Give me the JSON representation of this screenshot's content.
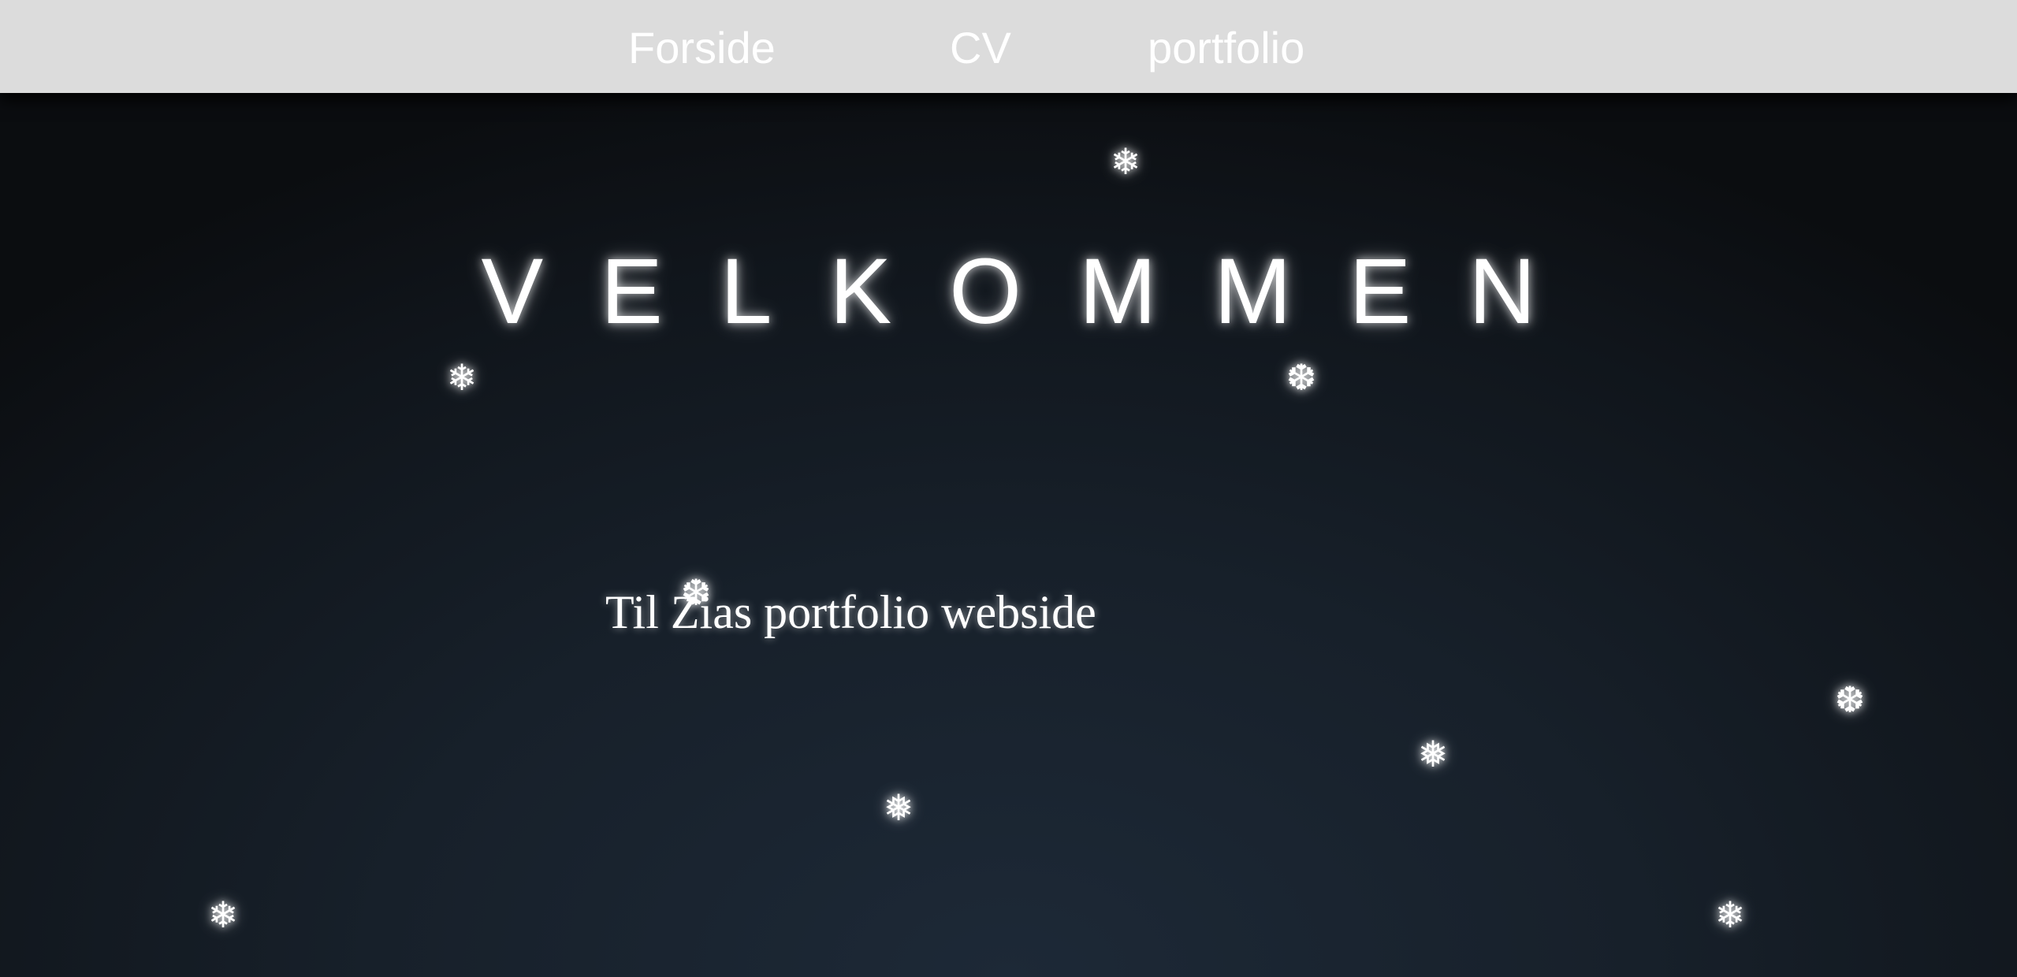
{
  "nav": {
    "items": [
      {
        "label": "Forside"
      },
      {
        "label": "CV"
      },
      {
        "label": "portfolio"
      }
    ]
  },
  "hero": {
    "title": "VELKOMMEN",
    "subtitle": "Til Zias portfolio webside"
  },
  "decorations": {
    "snowflake_glyphs": [
      "❄",
      "❆",
      "❅"
    ],
    "snowflake_icon": "snowflake-icon",
    "colors": {
      "navbar_bg": "#dcdcdc",
      "page_bg": "#141b23",
      "text": "#ffffff"
    }
  }
}
